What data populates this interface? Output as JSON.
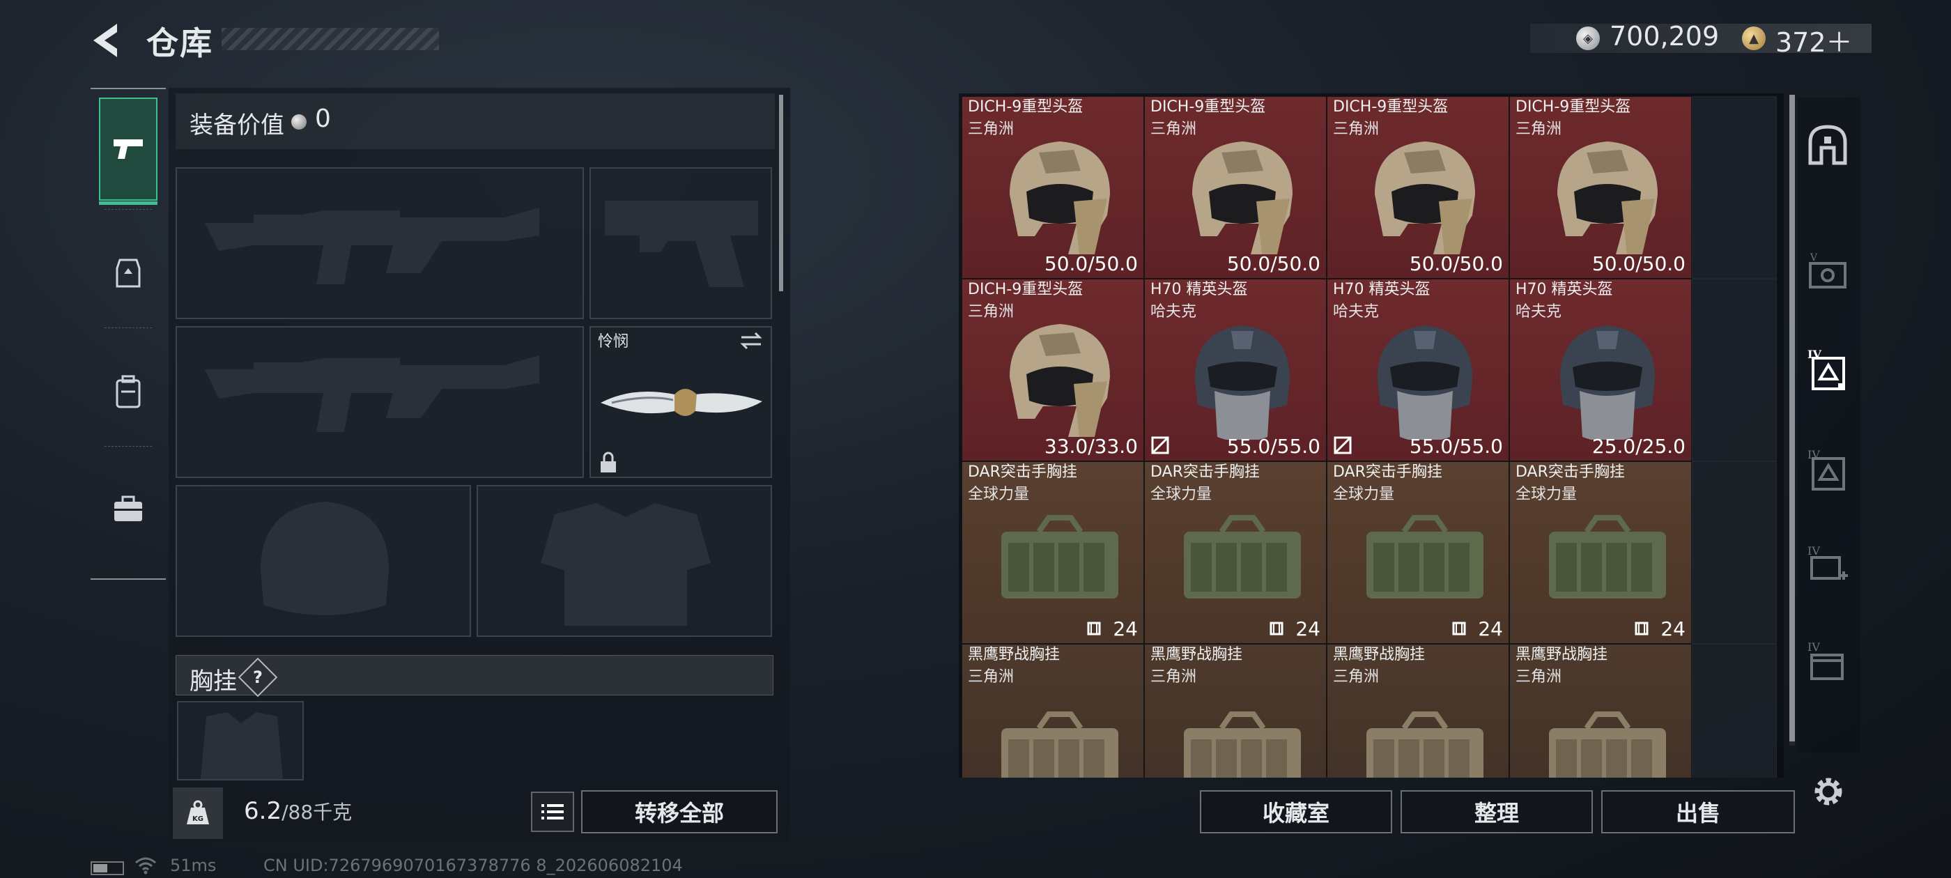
{
  "header": {
    "title": "仓库",
    "silver_amount": "700,209",
    "gold_amount": "372＋"
  },
  "equipment": {
    "value_label": "装备价值",
    "value": "0",
    "melee_name": "怜悯",
    "chest_label": "胸挂",
    "chest_help": "?",
    "weight_current": "6.2",
    "weight_max": "/88千克",
    "transfer_all_label": "转移全部"
  },
  "status": {
    "ping": "51ms",
    "uid": "CN UID:7267969070167378776 8_202606082104"
  },
  "inventory": {
    "items": [
      {
        "name": "DICH-9重型头盔",
        "brand": "三角洲",
        "value": "50.0/50.0",
        "kind": "helmet-tan",
        "bg": "red"
      },
      {
        "name": "DICH-9重型头盔",
        "brand": "三角洲",
        "value": "50.0/50.0",
        "kind": "helmet-tan",
        "bg": "red"
      },
      {
        "name": "DICH-9重型头盔",
        "brand": "三角洲",
        "value": "50.0/50.0",
        "kind": "helmet-tan",
        "bg": "red"
      },
      {
        "name": "DICH-9重型头盔",
        "brand": "三角洲",
        "value": "50.0/50.0",
        "kind": "helmet-tan",
        "bg": "red"
      },
      {
        "name": "DICH-9重型头盔",
        "brand": "三角洲",
        "value": "33.0/33.0",
        "kind": "helmet-tan",
        "bg": "red"
      },
      {
        "name": "H70 精英头盔",
        "brand": "哈夫克",
        "value": "55.0/55.0",
        "kind": "helmet-dark",
        "bg": "red",
        "tag": true
      },
      {
        "name": "H70 精英头盔",
        "brand": "哈夫克",
        "value": "55.0/55.0",
        "kind": "helmet-dark",
        "bg": "red",
        "tag": true
      },
      {
        "name": "H70 精英头盔",
        "brand": "哈夫克",
        "value": "25.0/25.0",
        "kind": "helmet-dark",
        "bg": "red"
      },
      {
        "name": "DAR突击手胸挂",
        "brand": "全球力量",
        "value": "24",
        "kind": "rig-green",
        "bg": "brown",
        "capacity": true
      },
      {
        "name": "DAR突击手胸挂",
        "brand": "全球力量",
        "value": "24",
        "kind": "rig-green",
        "bg": "brown",
        "capacity": true
      },
      {
        "name": "DAR突击手胸挂",
        "brand": "全球力量",
        "value": "24",
        "kind": "rig-green",
        "bg": "brown",
        "capacity": true
      },
      {
        "name": "DAR突击手胸挂",
        "brand": "全球力量",
        "value": "24",
        "kind": "rig-green",
        "bg": "brown",
        "capacity": true
      },
      {
        "name": "黑鹰野战胸挂",
        "brand": "三角洲",
        "value": "",
        "kind": "rig-tan",
        "bg": "brown2"
      },
      {
        "name": "黑鹰野战胸挂",
        "brand": "三角洲",
        "value": "",
        "kind": "rig-tan",
        "bg": "brown2"
      },
      {
        "name": "黑鹰野战胸挂",
        "brand": "三角洲",
        "value": "",
        "kind": "rig-tan",
        "bg": "brown2"
      },
      {
        "name": "黑鹰野战胸挂",
        "brand": "三角洲",
        "value": "",
        "kind": "rig-tan",
        "bg": "brown2"
      }
    ],
    "collection_label": "收藏室",
    "sort_label": "整理",
    "sell_label": "出售"
  },
  "colors": {
    "accent_green": "#3fbf8f",
    "rarity_red": "#6e2a2d",
    "rarity_brown": "#5a4030"
  }
}
